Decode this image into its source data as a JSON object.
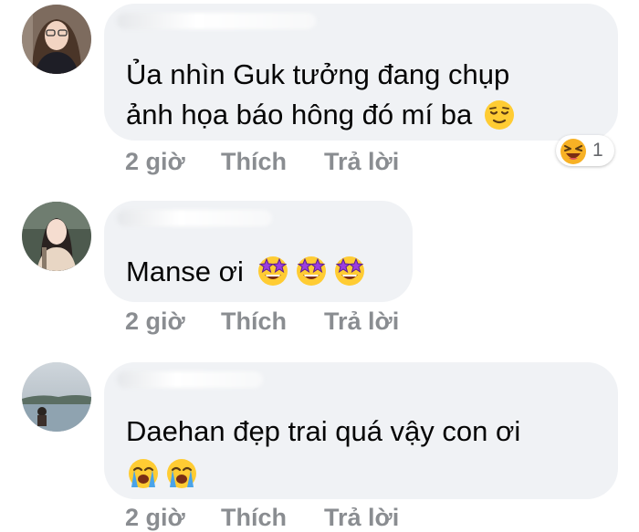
{
  "comments": [
    {
      "text": "Ủa nhìn Guk tưởng đang chụp ảnh họa báo hông đó mí ba",
      "text_line1": "Ủa nhìn Guk tưởng đang chụp",
      "text_line2": "ảnh họa báo hông đó mí ba",
      "emojis": [
        "relieved-face"
      ],
      "time": "2 giờ",
      "like_label": "Thích",
      "reply_label": "Trả lời",
      "reaction": {
        "emoji": "laughing-squint-face",
        "count": "1"
      }
    },
    {
      "text": "Manse ơi",
      "emojis": [
        "star-struck",
        "star-struck",
        "star-struck"
      ],
      "time": "2 giờ",
      "like_label": "Thích",
      "reply_label": "Trả lời"
    },
    {
      "text": "Daehan đẹp trai quá vậy con ơi",
      "emojis": [
        "loudly-crying-face",
        "loudly-crying-face"
      ],
      "time": "2 giờ",
      "like_label": "Thích",
      "reply_label": "Trả lời"
    }
  ],
  "colors": {
    "bubble": "#f0f2f5",
    "action_text": "#8a8d91",
    "body_text": "#050505"
  }
}
